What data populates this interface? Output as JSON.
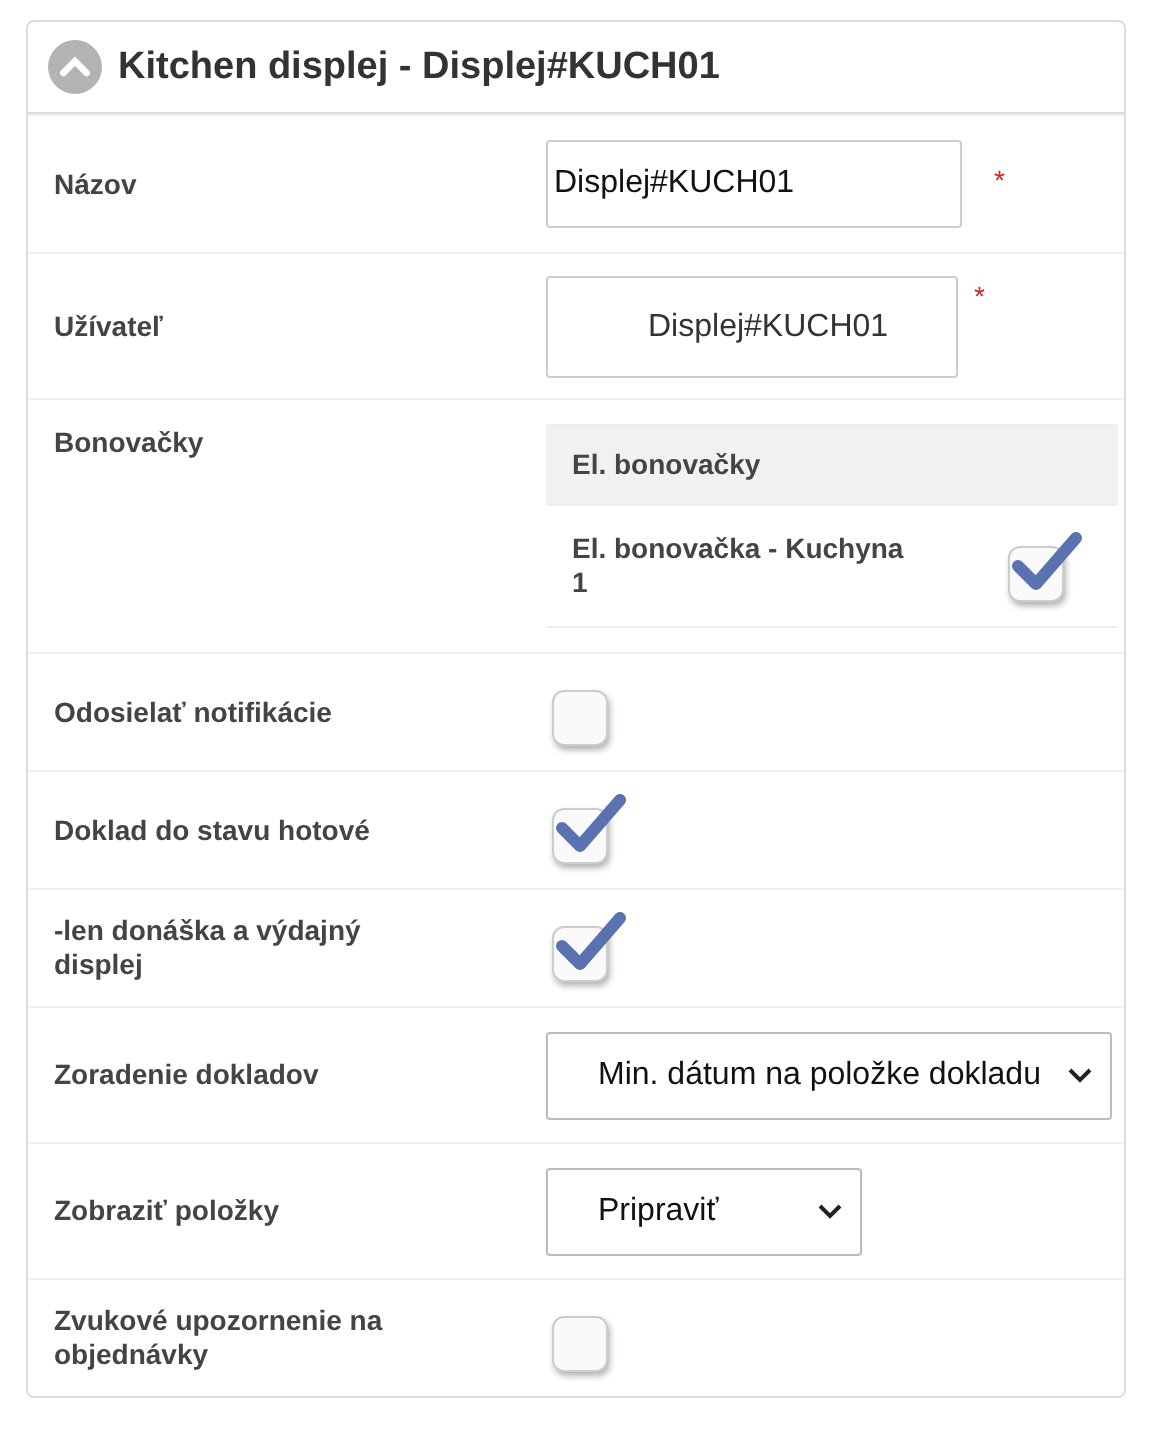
{
  "panel": {
    "title": "Kitchen displej - Displej#KUCH01",
    "expanded": true
  },
  "rows": [
    {
      "kind": "text",
      "label": "Názov",
      "value": "Displej#KUCH01",
      "required_mark": "*"
    },
    {
      "kind": "lookup",
      "label": "Užívateľ",
      "value": "Displej#KUCH01",
      "required_mark": "*"
    },
    {
      "kind": "table",
      "label": "Bonovačky",
      "columns": [
        "El. bonovačky"
      ],
      "items": [
        {
          "name": "El. bonovačka - Kuchyna 1",
          "checked": true
        }
      ]
    },
    {
      "kind": "checkbox",
      "label": "Odosielať notifikácie",
      "checked": false
    },
    {
      "kind": "checkbox",
      "label": "Doklad do stavu hotové",
      "checked": true
    },
    {
      "kind": "checkbox",
      "label": "-len donáška a výdajný displej",
      "checked": true
    },
    {
      "kind": "select",
      "label": "Zoradenie dokladov",
      "value": "Min. dátum na položke dokladu"
    },
    {
      "kind": "select",
      "label": "Zobraziť položky",
      "value": "Pripraviť"
    },
    {
      "kind": "checkbox",
      "label": "Zvukové upozornenie na objednávky",
      "checked": false
    }
  ]
}
